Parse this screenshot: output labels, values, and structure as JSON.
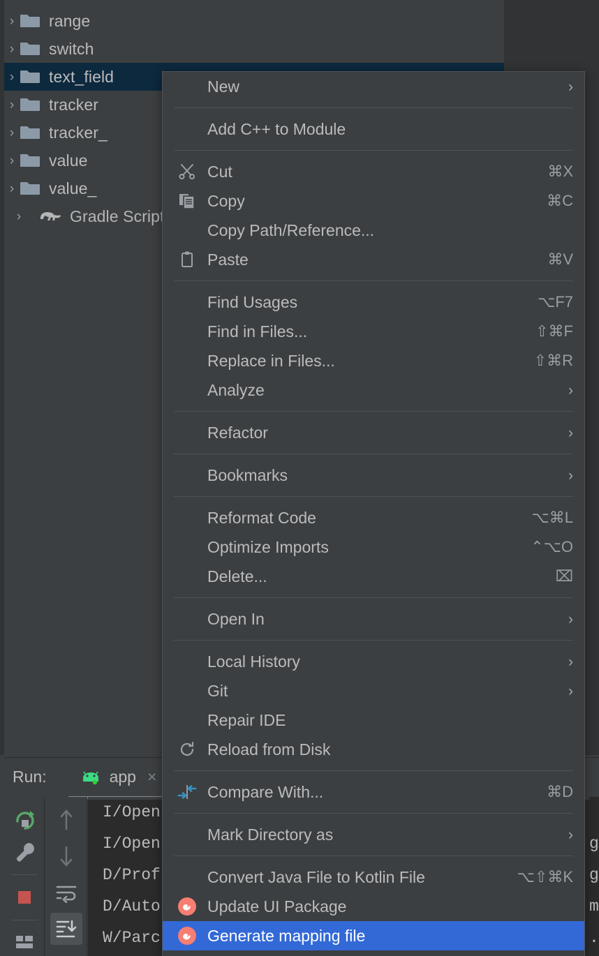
{
  "project_tree": {
    "rows": [
      {
        "label": "range",
        "icon": "folder-icon",
        "chevron": "›",
        "selected": false,
        "partial_top": false
      },
      {
        "label": "switch",
        "icon": "folder-icon",
        "chevron": "›",
        "selected": false,
        "partial_top": false
      },
      {
        "label": "text_field",
        "icon": "folder-icon",
        "chevron": "›",
        "selected": true,
        "partial_top": false
      },
      {
        "label": "tracker",
        "icon": "folder-icon",
        "chevron": "›",
        "selected": false,
        "partial_top": false
      },
      {
        "label": "tracker_",
        "icon": "folder-icon",
        "chevron": "›",
        "selected": false,
        "partial_top": false
      },
      {
        "label": "value",
        "icon": "folder-icon",
        "chevron": "›",
        "selected": false,
        "partial_top": false
      },
      {
        "label": "value_",
        "icon": "folder-icon",
        "chevron": "›",
        "selected": false,
        "partial_top": false
      },
      {
        "label": "Gradle Scripts",
        "icon": "gradle-elephant-icon",
        "chevron": "›",
        "selected": false,
        "partial_top": false
      }
    ]
  },
  "run_panel": {
    "title": "Run:",
    "tab_label": "app",
    "tab_icon": "android-robot-icon",
    "tab_close": "×",
    "toolbar_left": [
      {
        "name": "rerun-button",
        "icon": "rerun-icon"
      },
      {
        "name": "edit-config-button",
        "icon": "wrench-icon"
      },
      {
        "name": "stop-button",
        "icon": "stop-square-icon"
      },
      {
        "name": "layout-button",
        "icon": "layout-icon"
      }
    ],
    "toolbar_right": [
      {
        "name": "up-button",
        "icon": "arrow-up-icon",
        "active": false
      },
      {
        "name": "down-button",
        "icon": "arrow-down-icon",
        "active": false
      },
      {
        "name": "soft-wrap-button",
        "icon": "soft-wrap-icon",
        "active": false
      },
      {
        "name": "scroll-end-button",
        "icon": "scroll-to-end-icon",
        "active": true
      }
    ],
    "console_lines": [
      "I/Open",
      "I/Open",
      "D/Prof",
      "D/Auto",
      "W/Parc"
    ],
    "console_right_fragments": [
      "g",
      "g",
      "m",
      ".s",
      ""
    ]
  },
  "context_menu": {
    "items": [
      {
        "type": "item",
        "label": "New",
        "icon": null,
        "submenu": true,
        "shortcut": ""
      },
      {
        "type": "separator"
      },
      {
        "type": "item",
        "label": "Add C++ to Module",
        "icon": null,
        "submenu": false,
        "shortcut": ""
      },
      {
        "type": "separator"
      },
      {
        "type": "item",
        "label": "Cut",
        "icon": "scissors-icon",
        "submenu": false,
        "shortcut": "⌘X"
      },
      {
        "type": "item",
        "label": "Copy",
        "icon": "copy-icon",
        "submenu": false,
        "shortcut": "⌘C"
      },
      {
        "type": "item",
        "label": "Copy Path/Reference...",
        "icon": null,
        "submenu": false,
        "shortcut": ""
      },
      {
        "type": "item",
        "label": "Paste",
        "icon": "clipboard-icon",
        "submenu": false,
        "shortcut": "⌘V"
      },
      {
        "type": "separator"
      },
      {
        "type": "item",
        "label": "Find Usages",
        "icon": null,
        "submenu": false,
        "shortcut": "⌥F7"
      },
      {
        "type": "item",
        "label": "Find in Files...",
        "icon": null,
        "submenu": false,
        "shortcut": "⇧⌘F"
      },
      {
        "type": "item",
        "label": "Replace in Files...",
        "icon": null,
        "submenu": false,
        "shortcut": "⇧⌘R"
      },
      {
        "type": "item",
        "label": "Analyze",
        "icon": null,
        "submenu": true,
        "shortcut": ""
      },
      {
        "type": "separator"
      },
      {
        "type": "item",
        "label": "Refactor",
        "icon": null,
        "submenu": true,
        "shortcut": ""
      },
      {
        "type": "separator"
      },
      {
        "type": "item",
        "label": "Bookmarks",
        "icon": null,
        "submenu": true,
        "shortcut": ""
      },
      {
        "type": "separator"
      },
      {
        "type": "item",
        "label": "Reformat Code",
        "icon": null,
        "submenu": false,
        "shortcut": "⌥⌘L"
      },
      {
        "type": "item",
        "label": "Optimize Imports",
        "icon": null,
        "submenu": false,
        "shortcut": "⌃⌥O"
      },
      {
        "type": "item",
        "label": "Delete...",
        "icon": null,
        "submenu": false,
        "shortcut": "⌧"
      },
      {
        "type": "separator"
      },
      {
        "type": "item",
        "label": "Open In",
        "icon": null,
        "submenu": true,
        "shortcut": ""
      },
      {
        "type": "separator"
      },
      {
        "type": "item",
        "label": "Local History",
        "icon": null,
        "submenu": true,
        "shortcut": ""
      },
      {
        "type": "item",
        "label": "Git",
        "icon": null,
        "submenu": true,
        "shortcut": ""
      },
      {
        "type": "item",
        "label": "Repair IDE",
        "icon": null,
        "submenu": false,
        "shortcut": ""
      },
      {
        "type": "item",
        "label": "Reload from Disk",
        "icon": "reload-icon",
        "submenu": false,
        "shortcut": ""
      },
      {
        "type": "separator"
      },
      {
        "type": "item",
        "label": "Compare With...",
        "icon": "compare-icon",
        "submenu": false,
        "shortcut": "⌘D"
      },
      {
        "type": "separator"
      },
      {
        "type": "item",
        "label": "Mark Directory as",
        "icon": null,
        "submenu": true,
        "shortcut": ""
      },
      {
        "type": "separator"
      },
      {
        "type": "item",
        "label": "Convert Java File to Kotlin File",
        "icon": null,
        "submenu": false,
        "shortcut": "⌥⇧⌘K"
      },
      {
        "type": "item",
        "label": "Update UI Package",
        "icon": "plugin-icon",
        "submenu": false,
        "shortcut": ""
      },
      {
        "type": "item",
        "label": "Generate mapping file",
        "icon": "plugin-icon",
        "submenu": false,
        "shortcut": "",
        "highlighted": true
      }
    ]
  },
  "colors": {
    "menu_bg": "#3C3F41",
    "menu_border": "#515456",
    "separator": "#4E5254",
    "text": "#BBBBBB",
    "shortcut_text": "#9A9DA1",
    "highlight_bg": "#3369D6",
    "highlight_text": "#FFFFFF",
    "tree_selected_bg": "#0D293E",
    "console_bg": "#2B2B2B",
    "folder_icon": "#8C9AA8",
    "plugin_icon": "#F67E72",
    "android_green": "#3DDC84",
    "stop_red": "#C75450",
    "compare_blue": "#3592C4"
  }
}
